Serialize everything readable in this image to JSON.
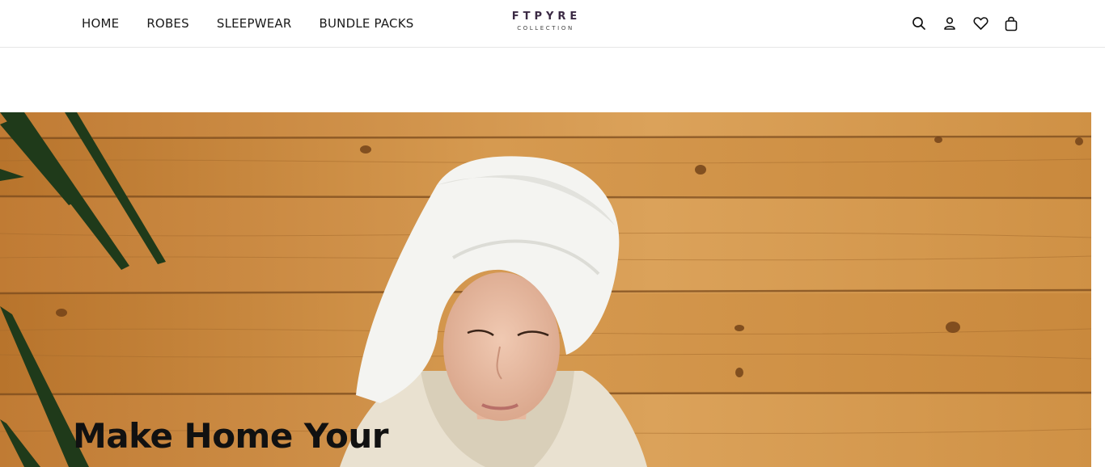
{
  "nav": {
    "items": [
      {
        "label": "HOME"
      },
      {
        "label": "ROBES"
      },
      {
        "label": "SLEEPWEAR"
      },
      {
        "label": "BUNDLE PACKS"
      }
    ]
  },
  "logo": {
    "main": "FTPYRE",
    "sub": "COLLECTION"
  },
  "header_icons": [
    "search-icon",
    "account-icon",
    "wishlist-heart-icon",
    "cart-bag-icon"
  ],
  "hero": {
    "headline": "Make Home Your",
    "image": "woman-with-towel-and-robe-in-sauna"
  },
  "colors": {
    "logo": "#3b2a44",
    "wood": "#c98a3f",
    "text": "#111111"
  }
}
